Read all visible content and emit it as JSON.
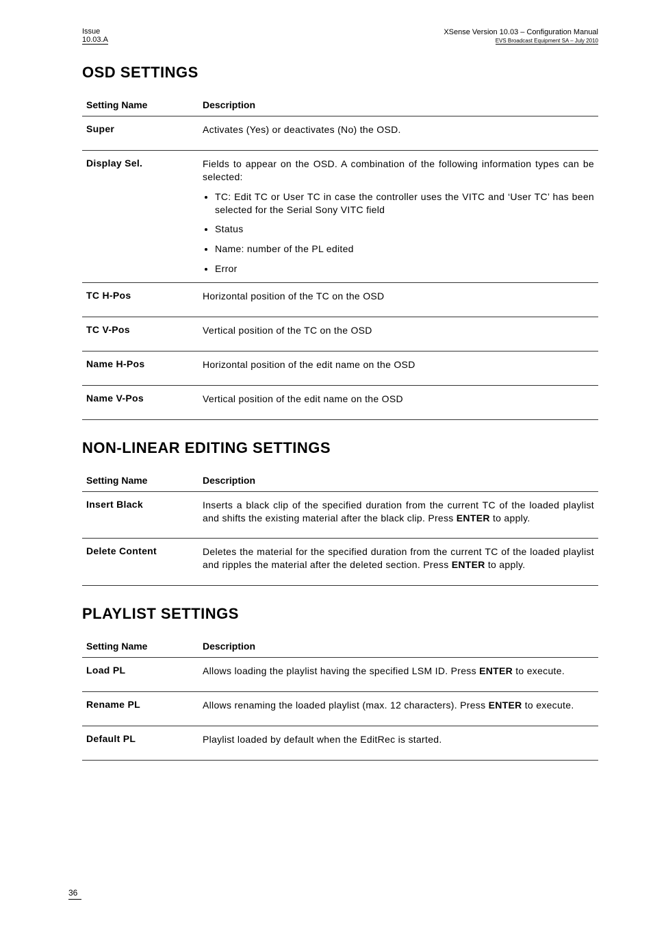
{
  "header": {
    "issue_label": "Issue",
    "issue_version": "10.03.A",
    "product_line": "XSense     Version 10.03 – Configuration Manual",
    "company_line": "EVS Broadcast Equipment SA – July 2010"
  },
  "sections": [
    {
      "title": "OSD SETTINGS",
      "col_name": "Setting Name",
      "col_desc": "Description",
      "rows": [
        {
          "name": "Super",
          "desc_paragraphs": [
            "Activates (Yes) or deactivates (No) the OSD."
          ]
        },
        {
          "name": "Display Sel.",
          "desc_paragraphs": [
            "Fields to appear on the OSD. A combination of the following information types can be selected:"
          ],
          "desc_bullets": [
            "TC: Edit TC or User TC in case the controller uses the VITC and ‘User TC’ has been selected for the Serial Sony VITC field",
            "Status",
            "Name: number of the PL edited",
            "Error"
          ]
        },
        {
          "name": "TC H-Pos",
          "desc_paragraphs": [
            "Horizontal position of the TC on the OSD"
          ]
        },
        {
          "name": "TC V-Pos",
          "desc_paragraphs": [
            "Vertical position of the TC on the OSD"
          ]
        },
        {
          "name": "Name H-Pos",
          "desc_paragraphs": [
            "Horizontal position of the edit name on the OSD"
          ]
        },
        {
          "name": "Name V-Pos",
          "desc_paragraphs": [
            "Vertical position of the edit name on the OSD"
          ]
        }
      ]
    },
    {
      "title": "NON-LINEAR EDITING SETTINGS",
      "col_name": "Setting Name",
      "col_desc": "Description",
      "rows": [
        {
          "name": "Insert Black",
          "desc_html": "Inserts a black clip of the specified duration from the current TC of the loaded playlist and shifts the existing material after the black clip. Press <strong>ENTER</strong> to apply."
        },
        {
          "name": "Delete Content",
          "desc_html": "Deletes the material for the specified duration from the current TC of the loaded playlist and ripples the material after the deleted section. Press <strong>ENTER</strong> to apply."
        }
      ]
    },
    {
      "title": "PLAYLIST SETTINGS",
      "col_name": "Setting Name",
      "col_desc": "Description",
      "rows": [
        {
          "name": "Load PL",
          "desc_html": "Allows loading the playlist having the specified LSM ID. Press <strong>ENTER</strong> to execute."
        },
        {
          "name": "Rename PL",
          "desc_html": "Allows renaming the loaded playlist (max. 12 characters). Press <strong>ENTER</strong> to execute."
        },
        {
          "name": "Default PL",
          "desc_paragraphs": [
            "Playlist loaded by default when the EditRec is started."
          ]
        }
      ]
    }
  ],
  "footer": {
    "page_number": "36"
  }
}
